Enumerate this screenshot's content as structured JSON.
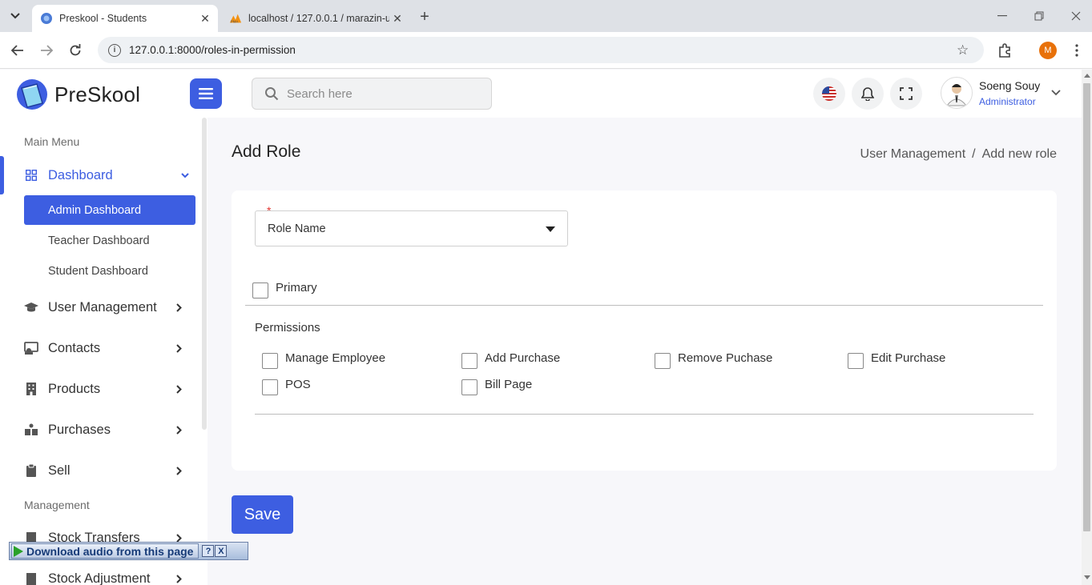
{
  "browser": {
    "tabs": [
      {
        "title": "Preskool - Students",
        "active": true
      },
      {
        "title": "localhost / 127.0.0.1 / marazin-u",
        "active": false
      }
    ],
    "url": "127.0.0.1:8000/roles-in-permission",
    "profile_initial": "M"
  },
  "header": {
    "logo_text": "PreSkool",
    "search_placeholder": "Search here",
    "user_name": "Soeng Souy",
    "user_role": "Administrator"
  },
  "sidebar": {
    "main_menu_title": "Main Menu",
    "dashboard_label": "Dashboard",
    "sub_items": [
      "Admin Dashboard",
      "Teacher Dashboard",
      "Student Dashboard"
    ],
    "items": [
      "User Management",
      "Contacts",
      "Products",
      "Purchases",
      "Sell"
    ],
    "management_title": "Management",
    "management_items": [
      "Stock Transfers",
      "Stock Adjustment"
    ]
  },
  "content": {
    "title": "Add Role",
    "breadcrumb": {
      "parent": "User Management",
      "separator": "/",
      "current": "Add new role"
    },
    "required_mark": "*",
    "role_select_value": "Role Name",
    "primary_label": "Primary",
    "permissions_title": "Permissions",
    "permissions": [
      "Manage Employee",
      "Add Purchase",
      "Remove Puchase",
      "Edit Purchase",
      "POS",
      "Bill Page"
    ],
    "save_label": "Save"
  },
  "audio_toolbar": {
    "label": "Download audio from this page",
    "help": "?",
    "close": "X"
  },
  "colors": {
    "accent": "#3d5ee1",
    "required": "#e3342f"
  }
}
